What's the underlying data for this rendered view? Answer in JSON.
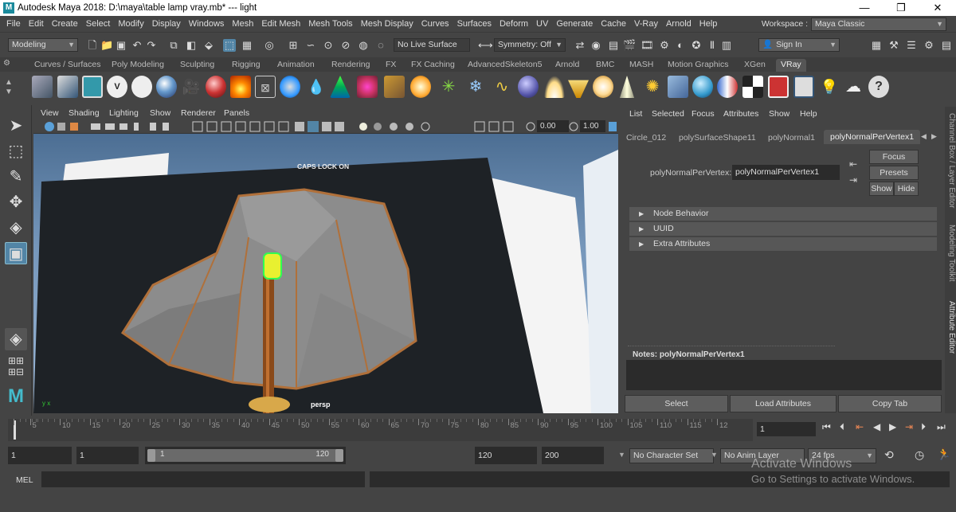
{
  "window": {
    "title": "Autodesk Maya 2018: D:\\maya\\table lamp vray.mb*   ---   light",
    "minimize": "—",
    "maximize": "❐",
    "close": "✕"
  },
  "menubar": {
    "items": [
      "File",
      "Edit",
      "Create",
      "Select",
      "Modify",
      "Display",
      "Windows",
      "Mesh",
      "Edit Mesh",
      "Mesh Tools",
      "Mesh Display",
      "Curves",
      "Surfaces",
      "Deform",
      "UV",
      "Generate",
      "Cache",
      "V-Ray",
      "Arnold",
      "Help"
    ],
    "workspace_label": "Workspace :",
    "workspace_value": "Maya Classic"
  },
  "statusline": {
    "mode": "Modeling",
    "live_surface": "No Live Surface",
    "symmetry": "Symmetry: Off",
    "sign_in": "Sign In"
  },
  "shelf": {
    "tabs": [
      "Curves / Surfaces",
      "Poly Modeling",
      "Sculpting",
      "Rigging",
      "Animation",
      "Rendering",
      "FX",
      "FX Caching",
      "AdvancedSkeleton5",
      "Arnold",
      "BMC",
      "MASH",
      "Motion Graphics",
      "XGen",
      "VRay"
    ],
    "active_tab": "VRay"
  },
  "viewport": {
    "menus": [
      "View",
      "Shading",
      "Lighting",
      "Show",
      "Renderer",
      "Panels"
    ],
    "field1": "0.00",
    "field2": "1.00",
    "caps_lock": "CAPS LOCK ON",
    "camera": "persp"
  },
  "attribute_editor": {
    "menus": [
      "List",
      "Selected",
      "Focus",
      "Attributes",
      "Show",
      "Help"
    ],
    "tabs": [
      "Circle_012",
      "polySurfaceShape11",
      "polyNormal1",
      "polyNormalPerVertex1"
    ],
    "node_label": "polyNormalPerVertex:",
    "node_value": "polyNormalPerVertex1",
    "focus": "Focus",
    "presets": "Presets",
    "show": "Show",
    "hide": "Hide",
    "sections": [
      "Node Behavior",
      "UUID",
      "Extra Attributes"
    ],
    "notes_label": "Notes:  polyNormalPerVertex1",
    "select": "Select",
    "load_attributes": "Load Attributes",
    "copy_tab": "Copy Tab"
  },
  "side_tabs": [
    "Channel Box / Layer Editor",
    "Modeling Toolkit",
    "Attribute Editor"
  ],
  "timeline": {
    "ticks": [
      "1",
      "5",
      "10",
      "15",
      "20",
      "25",
      "30",
      "35",
      "40",
      "45",
      "50",
      "55",
      "60",
      "65",
      "70",
      "75",
      "80",
      "85",
      "90",
      "95",
      "100",
      "105",
      "110",
      "115",
      "12"
    ],
    "current_frame": "1"
  },
  "range": {
    "start": "1",
    "playback_start": "1",
    "slider_start": "1",
    "slider_end": "120",
    "playback_end": "120",
    "end": "200",
    "character_set": "No Character Set",
    "anim_layer": "No Anim Layer",
    "fps": "24 fps"
  },
  "cmdline": {
    "label": "MEL"
  },
  "watermark": {
    "line1": "Activate Windows",
    "line2": "Go to Settings to activate Windows."
  }
}
